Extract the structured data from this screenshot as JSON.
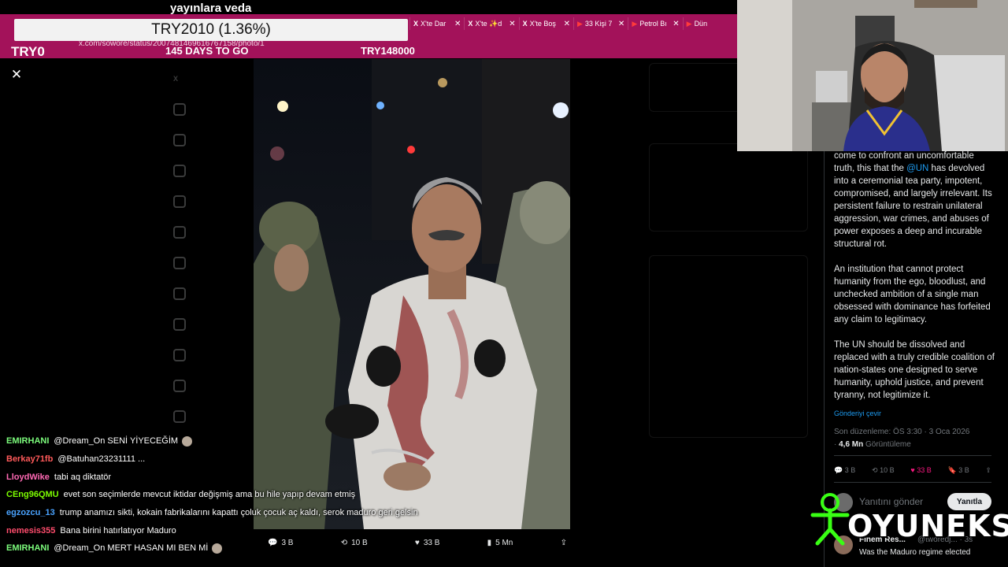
{
  "stream": {
    "title": "yayınlara veda",
    "ticker_main": "TRY2010 (1.36%)",
    "ticker_left": "TRY0",
    "days_to_go": "145 DAYS TO GO",
    "ticker_right": "TRY148000"
  },
  "browser": {
    "url": "x.com/sowore/status/2007481469616767158/photo/1",
    "tabs": [
      {
        "icon": "X",
        "label": "X'te Dar"
      },
      {
        "icon": "X",
        "label": "X'te ✨d"
      },
      {
        "icon": "X",
        "label": "X'te Boş"
      },
      {
        "icon": "▶",
        "label": "33 Kişi 7"
      },
      {
        "icon": "▶",
        "label": "Petrol Bı"
      },
      {
        "icon": "▶",
        "label": "Dün"
      }
    ]
  },
  "media_actions": {
    "replies": "3 B",
    "reposts": "10 B",
    "likes": "33 B",
    "views": "5 Mn"
  },
  "post": {
    "lead": "come to confront an uncomfortable truth, this that the",
    "mention": "@UN",
    "para1_rest": " has devolved into a ceremonial tea party, impotent, compromised, and largely irrelevant. Its persistent failure to restrain unilateral aggression, war crimes, and abuses of power exposes a deep and incurable structural rot.",
    "para2": "An institution that cannot protect humanity from the ego, bloodlust, and unchecked ambition of a single man obsessed with dominance has forfeited any claim to legitimacy.",
    "para3": "The UN should be dissolved and replaced with a truly credible coalition of nation-states one designed to serve humanity, uphold justice, and prevent tyranny, not legitimize it.",
    "translate": "Gönderiyi çevir",
    "edited": "Son düzenleme: ÖS 3:30 · 3 Oca 2026",
    "views_count": "4,6 Mn",
    "views_label": "Görüntüleme",
    "replies": "3 B",
    "reposts": "10 B",
    "likes": "33 B",
    "bookmarks": "3 B",
    "like_color": "#f91880"
  },
  "reply": {
    "placeholder": "Yanıtını gönder",
    "button": "Yanıtla",
    "author": "Finem Res...",
    "handle": "@tworedj... · 3s",
    "text": "Was the Maduro regime elected"
  },
  "logo": {
    "text": "OYUNEKS"
  },
  "chat": [
    {
      "user": "EMIRHANI",
      "color": "#7cfc7c",
      "text": "@Dream_On SENİ YİYECEĞİM",
      "emote": true
    },
    {
      "user": "Berkay71fb",
      "color": "#ff5a5a",
      "text": "@Batuhan23231111 ...",
      "emote": false
    },
    {
      "user": "LloydWike",
      "color": "#ff69b4",
      "text": "tabi aq diktatör",
      "emote": false
    },
    {
      "user": "CEng96QMU",
      "color": "#7cfc00",
      "text": "evet son seçimlerde mevcut iktidar değişmiş ama bu hile yapıp devam etmiş",
      "emote": false
    },
    {
      "user": "egzozcu_13",
      "color": "#4aa3ff",
      "text": "trump anamızı sikti, kokain fabrikalarını kapattı çoluk çocuk aç kaldı, serok maduro geri gelsin",
      "emote": false
    },
    {
      "user": "nemesis355",
      "color": "#ff4d6d",
      "text": "Bana birini hatırlatıyor Maduro",
      "emote": false
    },
    {
      "user": "EMIRHANI",
      "color": "#7cfc7c",
      "text": "@Dream_On MERT HASAN MI BEN Mİ",
      "emote": true
    }
  ]
}
